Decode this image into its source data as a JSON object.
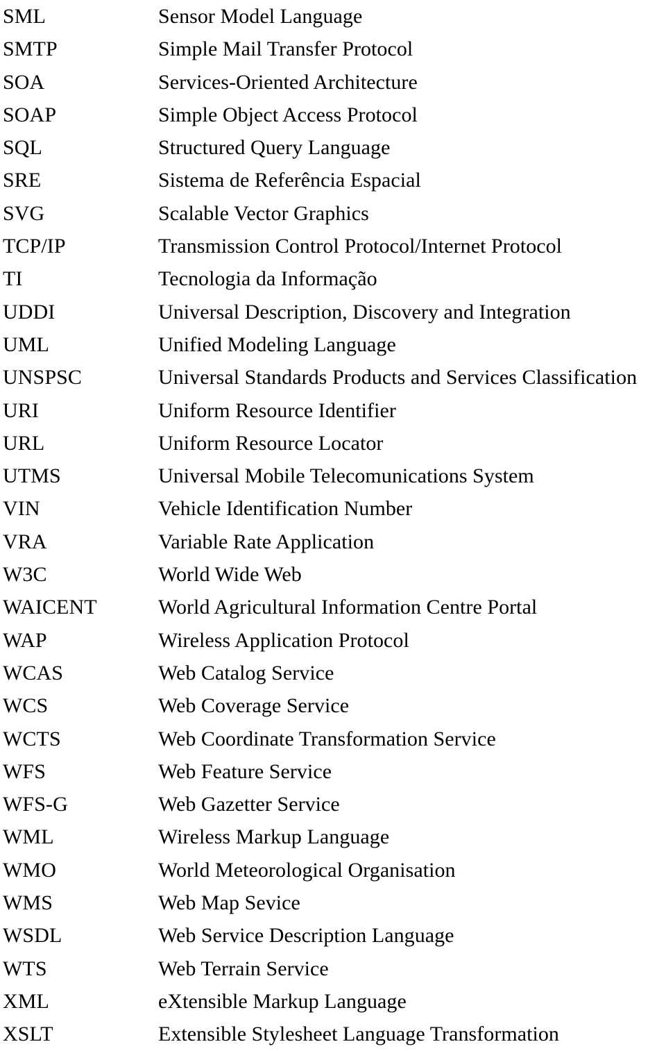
{
  "document": {
    "type": "glossary-of-acronyms",
    "background_color": "#ffffff",
    "text_color": "#000000",
    "column_headers": {
      "term": "",
      "definition": ""
    },
    "entries": [
      {
        "term": "SML",
        "definition": "Sensor Model Language"
      },
      {
        "term": "SMTP",
        "definition": "Simple Mail Transfer Protocol"
      },
      {
        "term": "SOA",
        "definition": "Services-Oriented Architecture"
      },
      {
        "term": "SOAP",
        "definition": "Simple Object Access Protocol"
      },
      {
        "term": "SQL",
        "definition": "Structured Query Language"
      },
      {
        "term": "SRE",
        "definition": "Sistema de Referência Espacial"
      },
      {
        "term": "SVG",
        "definition": "Scalable Vector Graphics"
      },
      {
        "term": "TCP/IP",
        "definition": "Transmission Control Protocol/Internet Protocol"
      },
      {
        "term": "TI",
        "definition": "Tecnologia da Informação"
      },
      {
        "term": "UDDI",
        "definition": "Universal Description, Discovery and Integration"
      },
      {
        "term": "UML",
        "definition": "Unified Modeling Language"
      },
      {
        "term": "UNSPSC",
        "definition": "Universal Standards Products and Services Classification"
      },
      {
        "term": "URI",
        "definition": "Uniform Resource Identifier"
      },
      {
        "term": "URL",
        "definition": "Uniform Resource Locator"
      },
      {
        "term": "UTMS",
        "definition": "Universal Mobile Telecomunications System"
      },
      {
        "term": "VIN",
        "definition": "Vehicle Identification Number"
      },
      {
        "term": "VRA",
        "definition": "Variable Rate Application"
      },
      {
        "term": "W3C",
        "definition": "World Wide Web"
      },
      {
        "term": "WAICENT",
        "definition": "World Agricultural Information Centre Portal"
      },
      {
        "term": "WAP",
        "definition": "Wireless Application Protocol"
      },
      {
        "term": "WCAS",
        "definition": "Web Catalog Service"
      },
      {
        "term": "WCS",
        "definition": "Web Coverage Service"
      },
      {
        "term": "WCTS",
        "definition": "Web Coordinate Transformation Service"
      },
      {
        "term": "WFS",
        "definition": "Web Feature Service"
      },
      {
        "term": "WFS-G",
        "definition": "Web Gazetter Service"
      },
      {
        "term": "WML",
        "definition": "Wireless Markup Language"
      },
      {
        "term": "WMO",
        "definition": "World Meteorological Organisation"
      },
      {
        "term": "WMS",
        "definition": "Web Map Sevice"
      },
      {
        "term": "WSDL",
        "definition": "Web Service Description Language"
      },
      {
        "term": "WTS",
        "definition": "Web Terrain Service"
      },
      {
        "term": "XML",
        "definition": "eXtensible Markup Language"
      },
      {
        "term": "XSLT",
        "definition": "Extensible Stylesheet Language Transformation"
      }
    ]
  }
}
